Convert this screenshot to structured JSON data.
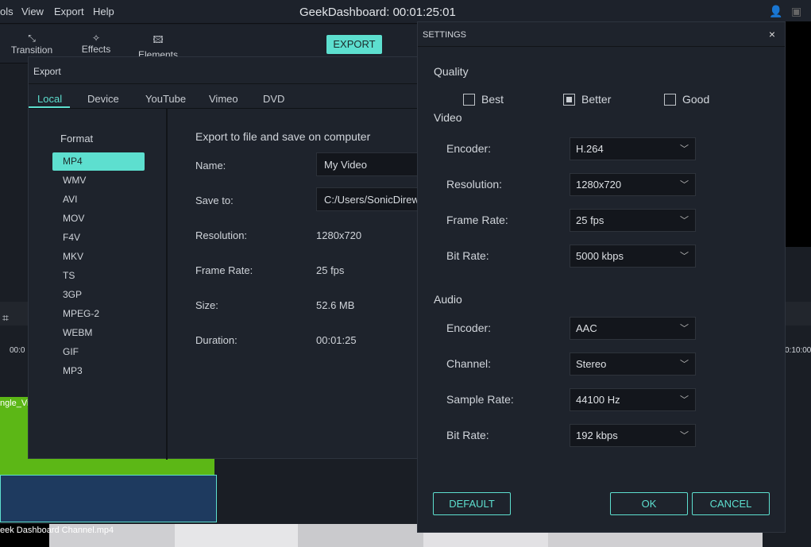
{
  "menu": {
    "items": [
      "ols",
      "View",
      "Export",
      "Help"
    ],
    "title": "GeekDashboard:  00:01:25:01"
  },
  "toolbar": {
    "transition": "Transition",
    "effects": "Effects",
    "elements": "Elements",
    "export": "EXPORT"
  },
  "timeline": {
    "clip_label": "ngle_Vic",
    "clip2_label": "eek Dashboard Channel.mp4",
    "time_left": "00:0",
    "time_right": "0:10:00"
  },
  "export_dialog": {
    "title": "Export",
    "tabs": [
      "Local",
      "Device",
      "YouTube",
      "Vimeo",
      "DVD"
    ],
    "active_tab": "Local",
    "format_label": "Format",
    "formats": [
      "MP4",
      "WMV",
      "AVI",
      "MOV",
      "F4V",
      "MKV",
      "TS",
      "3GP",
      "MPEG-2",
      "WEBM",
      "GIF",
      "MP3"
    ],
    "selected_format": "MP4",
    "heading": "Export to file and save on computer",
    "name_label": "Name:",
    "name_value": "My Video",
    "save_label": "Save to:",
    "save_value": "C:/Users/SonicDirew",
    "resolution_label": "Resolution:",
    "resolution_value": "1280x720",
    "framerate_label": "Frame Rate:",
    "framerate_value": "25 fps",
    "size_label": "Size:",
    "size_value": "52.6 MB",
    "duration_label": "Duration:",
    "duration_value": "00:01:25"
  },
  "settings": {
    "title": "SETTINGS",
    "quality_label": "Quality",
    "quality_options": [
      "Best",
      "Better",
      "Good"
    ],
    "quality_selected": "Better",
    "video_label": "Video",
    "video": [
      {
        "label": "Encoder:",
        "value": "H.264"
      },
      {
        "label": "Resolution:",
        "value": "1280x720"
      },
      {
        "label": "Frame Rate:",
        "value": "25 fps"
      },
      {
        "label": "Bit Rate:",
        "value": "5000 kbps"
      }
    ],
    "audio_label": "Audio",
    "audio": [
      {
        "label": "Encoder:",
        "value": "AAC"
      },
      {
        "label": "Channel:",
        "value": "Stereo"
      },
      {
        "label": "Sample Rate:",
        "value": "44100 Hz"
      },
      {
        "label": "Bit Rate:",
        "value": "192 kbps"
      }
    ],
    "default": "DEFAULT",
    "ok": "OK",
    "cancel": "CANCEL"
  },
  "colors": {
    "accent": "#5ddfcf",
    "background": "#1e232c",
    "clip_green": "#5cb716",
    "clip_blue": "#1e3a5f"
  }
}
